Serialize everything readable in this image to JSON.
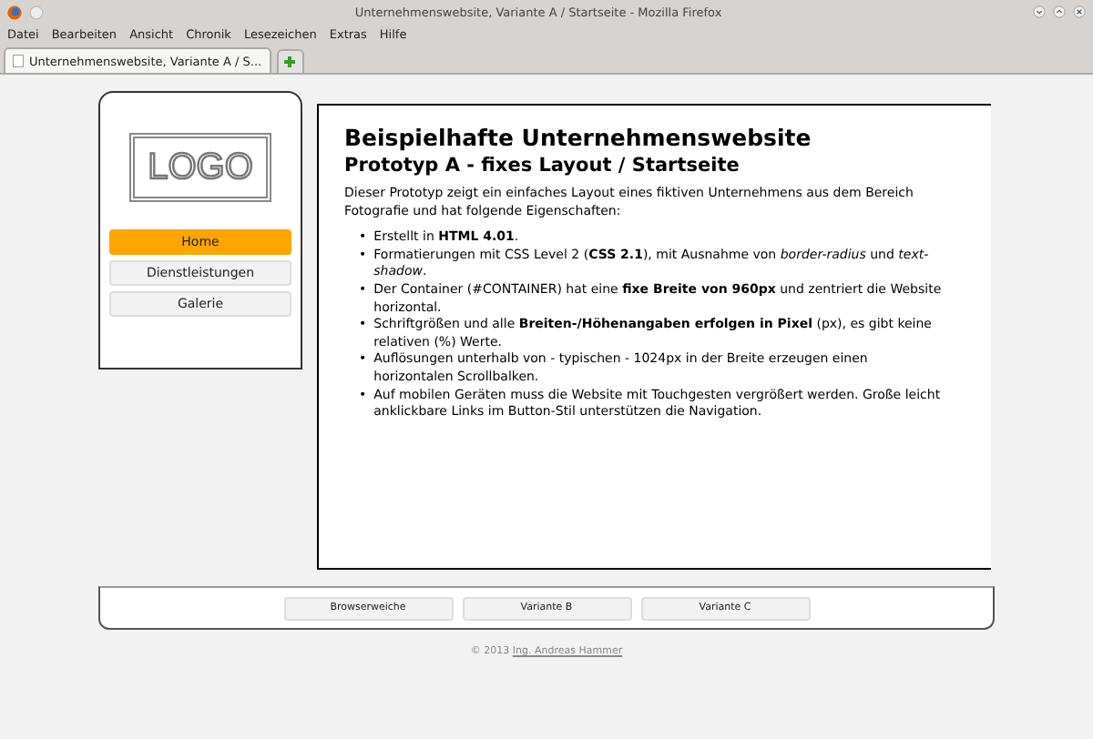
{
  "window": {
    "title": "Unternehmenswebsite, Variante A / Startseite - Mozilla Firefox"
  },
  "menu": [
    "Datei",
    "Bearbeiten",
    "Ansicht",
    "Chronik",
    "Lesezeichen",
    "Extras",
    "Hilfe"
  ],
  "tabs": [
    {
      "label": "Unternehmenswebsite, Variante A / S...",
      "selected": true
    }
  ],
  "sidebar": {
    "logo": "LOGO",
    "nav": [
      {
        "label": "Home",
        "selected": true
      },
      {
        "label": "Dienstleistungen",
        "selected": false
      },
      {
        "label": "Galerie",
        "selected": false
      }
    ]
  },
  "main": {
    "heading": "Beispielhafte Unternehmenswebsite",
    "subheading": "Prototyp A - fixes Layout / Startseite",
    "intro": "Dieser Prototyp zeigt ein einfaches Layout eines fiktiven Unternehmens aus dem Bereich Fotografie und hat folgende Eigenschaften:",
    "bullets": [
      {
        "marker": "•",
        "text": "Erstellt in **HTML 4.01**."
      },
      {
        "marker": "•",
        "text": "Formatierungen mit CSS Level 2 (**CSS 2.1**), mit Ausnahme von *border-radius* und *text-shadow*."
      },
      {
        "marker": "•",
        "text": "Der Container (#CONTAINER) hat eine **fixe Breite von 960px** und zentriert die Website horizontal."
      },
      {
        "marker": "•",
        "text": "Schriftgrößen und alle **Breiten-/Höhenangaben erfolgen in Pixel** (px), es gibt keine relativen (%) Werte."
      },
      {
        "marker": "•",
        "text": "Auflösungen unterhalb von - typischen - 1024px in der Breite erzeugen einen horizontalen Scrollbalken."
      },
      {
        "marker": "•",
        "text": "Auf mobilen Geräten muss die Website mit Touchgesten vergrößert werden. Große leicht anklickbare Links im Button-Stil unterstützen die Navigation."
      }
    ]
  },
  "footer_nav": [
    "Browserweiche",
    "Variante B",
    "Variante C"
  ],
  "copyright": {
    "text": "© 2013",
    "link": "Ing. Andreas Hammer"
  }
}
